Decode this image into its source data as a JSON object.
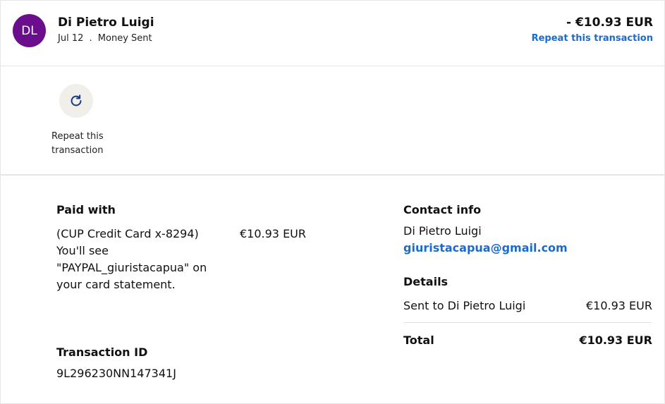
{
  "header": {
    "avatar_initials": "DL",
    "avatar_color": "#6a0e8e",
    "name": "Di Pietro Luigi",
    "date": "Jul 12",
    "separator": ".",
    "type": "Money Sent",
    "amount": "- €10.93 EUR",
    "repeat_link": "Repeat this transaction"
  },
  "actions": {
    "repeat_icon": "refresh-icon",
    "repeat_label": "Repeat this transaction"
  },
  "paid_with": {
    "heading": "Paid with",
    "card_line1": "(CUP Credit Card x-8294)",
    "card_line2": "You'll see \"PAYPAL_giuristacapua\" on your card statement.",
    "amount": "€10.93 EUR"
  },
  "transaction": {
    "heading": "Transaction ID",
    "id": "9L296230NN147341J"
  },
  "contact": {
    "heading": "Contact info",
    "name": "Di Pietro Luigi",
    "email": "giuristacapua@gmail.com"
  },
  "details": {
    "heading": "Details",
    "sent_to": "Sent to Di Pietro Luigi",
    "sent_amount": "€10.93 EUR",
    "total_label": "Total",
    "total_amount": "€10.93 EUR"
  },
  "colors": {
    "link": "#1a6bd0",
    "avatar": "#6a0e8e"
  }
}
